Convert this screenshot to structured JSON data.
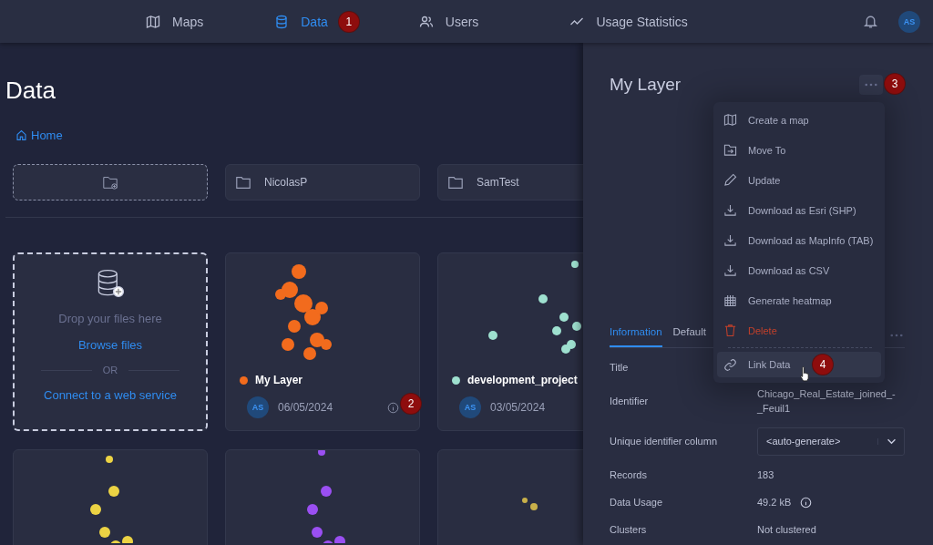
{
  "nav": {
    "items": [
      {
        "label": "Maps",
        "selected": false
      },
      {
        "label": "Data",
        "selected": true,
        "badge": "1"
      },
      {
        "label": "Users",
        "selected": false
      },
      {
        "label": "Usage Statistics",
        "selected": false
      }
    ],
    "avatar": "AS"
  },
  "page": {
    "title": "Data",
    "breadcrumb": "Home",
    "folders": [
      "NicolasP",
      "SamTest"
    ]
  },
  "upload": {
    "prompt": "Drop your files here",
    "browse": "Browse files",
    "separator": "OR",
    "connect": "Connect to a web service"
  },
  "layers": [
    {
      "name": "My Layer",
      "color": "#f26b1d",
      "avatar": "AS",
      "date": "06/05/2024",
      "info_button": true,
      "badge": "2"
    },
    {
      "name": "development_project",
      "color": "#9ee0cf",
      "avatar": "AS",
      "date": "03/05/2024"
    },
    {
      "color": "#ecd344"
    },
    {
      "color": "#9a4ff2"
    },
    {
      "color": "#c8b04a"
    }
  ],
  "panel": {
    "title": "My Layer",
    "more_badge": "3",
    "tabs": [
      {
        "label": "Information",
        "selected": true
      },
      {
        "label": "Default",
        "selected": false
      }
    ],
    "fields": [
      {
        "label": "Title",
        "kind": "text"
      },
      {
        "label": "Identifier",
        "kind": "text",
        "value": "Chicago_Real_Estate_joined_-_Feuil1"
      },
      {
        "label": "Unique identifier column",
        "kind": "select",
        "value": "<auto-generate>"
      },
      {
        "label": "Records",
        "kind": "text",
        "value": "183"
      },
      {
        "label": "Data Usage",
        "kind": "info",
        "value": "49.2 kB"
      },
      {
        "label": "Clusters",
        "kind": "text",
        "value": "Not clustered"
      }
    ]
  },
  "menu": {
    "items": [
      {
        "label": "Create a map",
        "kind": "normal"
      },
      {
        "label": "Move To",
        "kind": "normal"
      },
      {
        "label": "Update",
        "kind": "normal"
      },
      {
        "label": "Download as Esri (SHP)",
        "kind": "normal"
      },
      {
        "label": "Download as MapInfo (TAB)",
        "kind": "normal"
      },
      {
        "label": "Download as CSV",
        "kind": "normal"
      },
      {
        "label": "Generate heatmap",
        "kind": "normal"
      },
      {
        "label": "Delete",
        "kind": "danger"
      }
    ],
    "footer_items": [
      {
        "label": "Link Data",
        "highlighted": true,
        "badge": "4"
      }
    ]
  }
}
